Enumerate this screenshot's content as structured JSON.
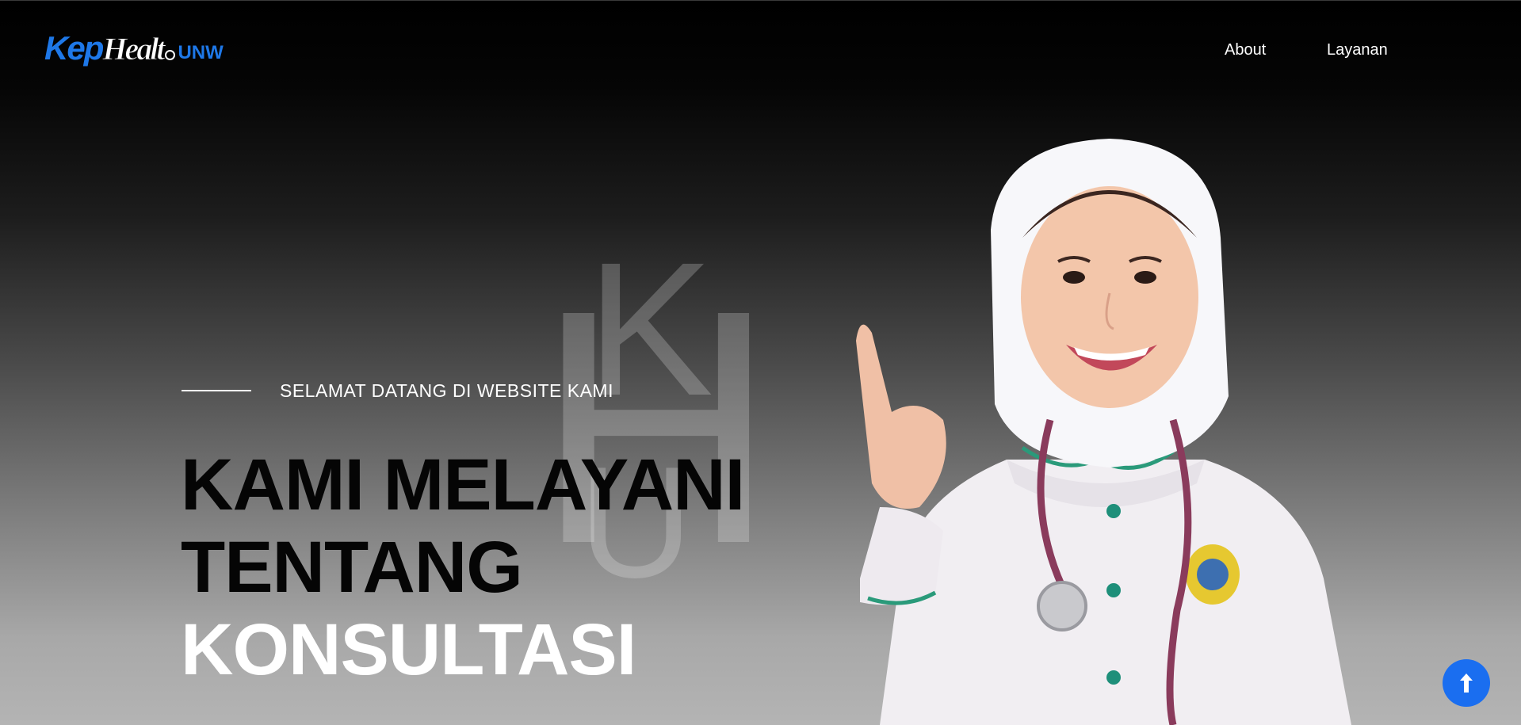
{
  "header": {
    "logo": {
      "part1": "Kep",
      "part2": "Healt",
      "part3": "UNW"
    },
    "nav": [
      {
        "label": "About"
      },
      {
        "label": "Layanan"
      }
    ]
  },
  "hero": {
    "subtitle": "SELAMAT DATANG DI WEBSITE KAMI",
    "title_line1": "KAMI MELAYANI",
    "title_line2": "TENTANG",
    "title_line3": "KONSULTASI",
    "watermark": {
      "k": "K",
      "h": "H",
      "u": "U"
    }
  },
  "back_to_top": {
    "icon": "arrow-up-icon"
  },
  "colors": {
    "accent": "#1a6ef0",
    "logo_blue": "#1e78e8"
  }
}
